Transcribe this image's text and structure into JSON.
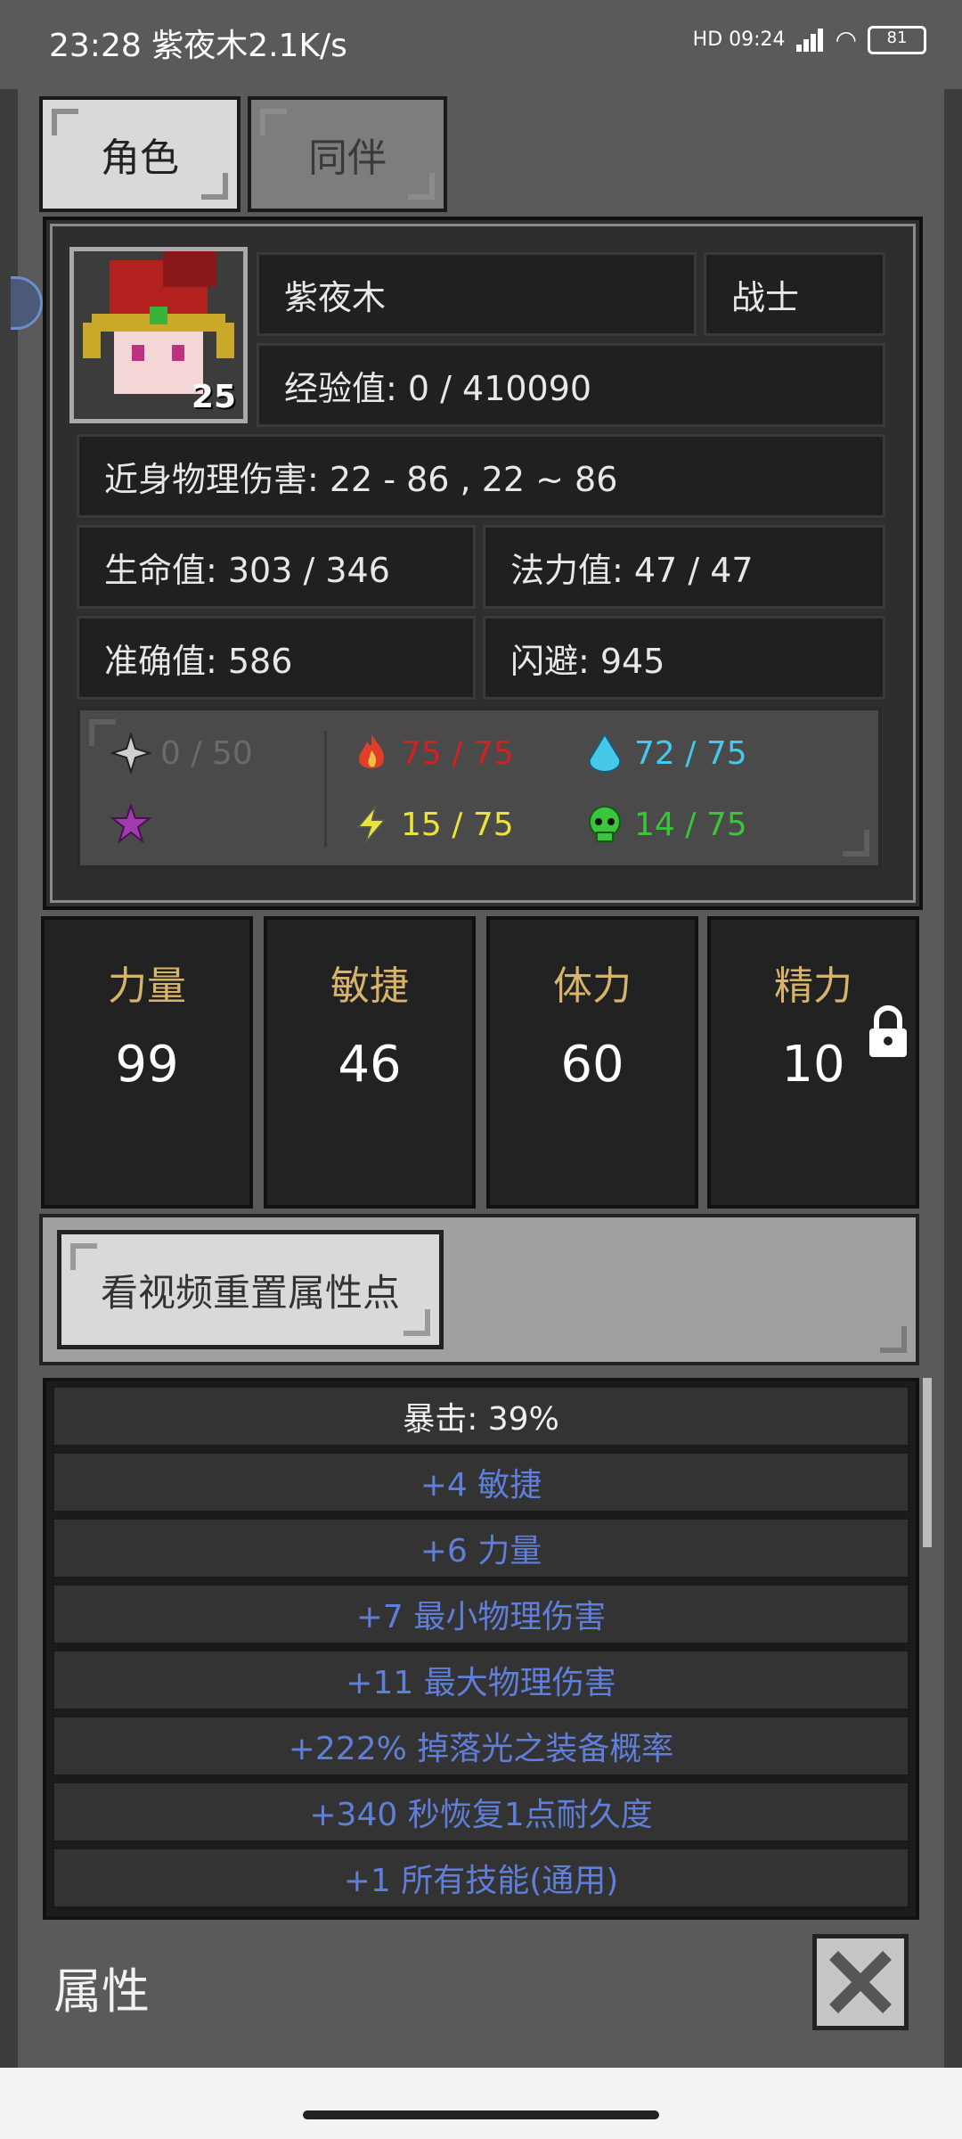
{
  "status": {
    "left_text": "23:28 紫夜木2.1K/s",
    "right_text": "HD 09:24",
    "battery": "81"
  },
  "tabs": [
    {
      "label": "角色",
      "active": true
    },
    {
      "label": "同伴",
      "active": false
    }
  ],
  "character": {
    "name": "紫夜木",
    "class": "战士",
    "level": "25",
    "exp": "经验值: 0 / 410090",
    "melee_damage": "近身物理伤害: 22 - 86 , 22 ~ 86",
    "hp": "生命值: 303 / 346",
    "mp": "法力值: 47 / 47",
    "accuracy": "准确值: 586",
    "dodge": "闪避: 945"
  },
  "resistances": {
    "physical": {
      "text": "0 / 50",
      "color": "#6a6a6a",
      "icon": "shuriken-icon"
    },
    "fire": {
      "text": "75 / 75",
      "color": "#d32020",
      "icon": "fire-icon"
    },
    "cold": {
      "text": "72 / 75",
      "color": "#45c8ea",
      "icon": "ice-drop-icon"
    },
    "magic": {
      "text": "",
      "color": "#a13bb0",
      "icon": "magic-star-icon"
    },
    "lightning": {
      "text": "15 / 75",
      "color": "#e8e43a",
      "icon": "lightning-icon"
    },
    "poison": {
      "text": "14 / 75",
      "color": "#3cc43c",
      "icon": "skull-icon"
    }
  },
  "stats": [
    {
      "name": "力量",
      "value": "99"
    },
    {
      "name": "敏捷",
      "value": "46"
    },
    {
      "name": "体力",
      "value": "60"
    },
    {
      "name": "精力",
      "value": "10"
    }
  ],
  "reset_button": "看视频重置属性点",
  "attributes": [
    "暴击: 39%",
    "+4 敏捷",
    "+6 力量",
    "+7 最小物理伤害",
    "+11 最大物理伤害",
    "+222% 掉落光之装备概率",
    "+340 秒恢复1点耐久度",
    "+1 所有技能(通用)"
  ],
  "bottom_title": "属性",
  "colors": {
    "stat_label": "#d8b46a",
    "attr_blue": "#5f7fd8"
  }
}
